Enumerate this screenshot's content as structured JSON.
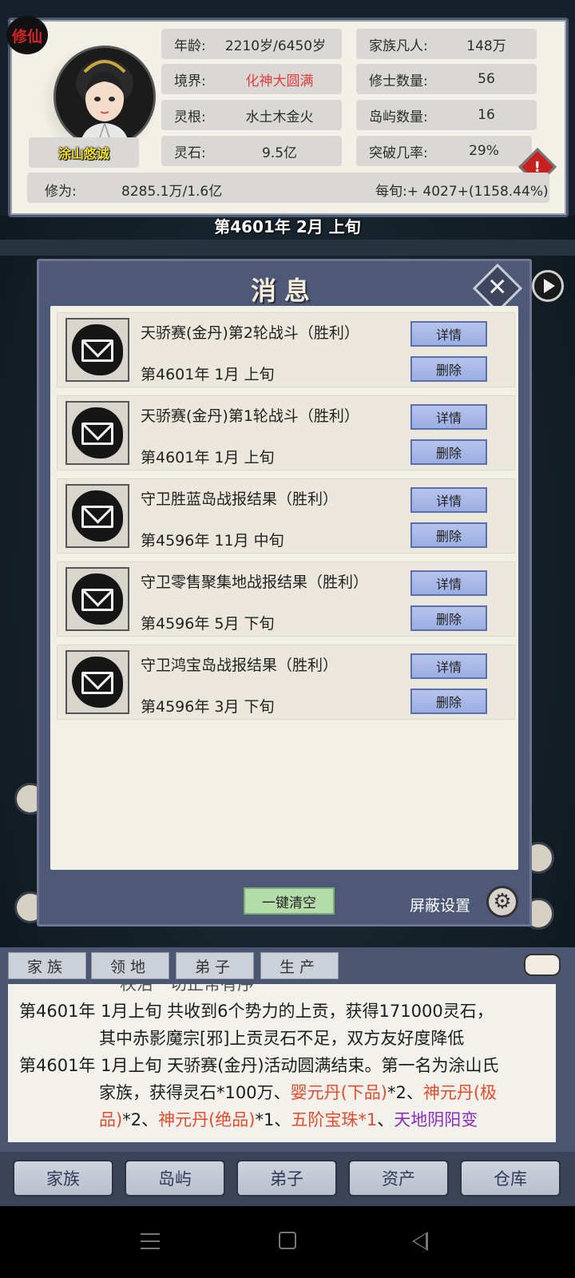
{
  "status": {
    "badge": "修仙",
    "name": "涂山悠诚",
    "age_label": "年龄:",
    "age_value": "2210岁/6450岁",
    "realm_label": "境界:",
    "realm_value": "化神大圆满",
    "root_label": "灵根:",
    "root_value": "水土木金火",
    "stone_label": "灵石:",
    "stone_value": "9.5亿",
    "mortals_label": "家族凡人:",
    "mortals_value": "148万",
    "cultivators_label": "修士数量:",
    "cultivators_value": "56",
    "islands_label": "岛屿数量:",
    "islands_value": "16",
    "breakthrough_label": "突破几率:",
    "breakthrough_value": "29%",
    "warning": "!",
    "cultivation_label": "修为:",
    "cultivation_value": "8285.1万/1.6亿",
    "rate": "每旬:+ 4027+(1158.44%)",
    "realm_color": "#e63c3c"
  },
  "current_date": "第4601年 2月 上旬",
  "dialog": {
    "title": "消息",
    "close": "✕",
    "details_label": "详情",
    "delete_label": "删除",
    "messages": [
      {
        "title": "天骄赛(金丹)第2轮战斗（胜利）",
        "date": "第4601年 1月 上旬"
      },
      {
        "title": "天骄赛(金丹)第1轮战斗（胜利）",
        "date": "第4601年 1月 上旬"
      },
      {
        "title": "守卫胜蓝岛战报结果（胜利）",
        "date": "第4596年 11月 中旬"
      },
      {
        "title": "守卫零售聚集地战报结果（胜利）",
        "date": "第4596年 5月 下旬"
      },
      {
        "title": "守卫鸿宝岛战报结果（胜利）",
        "date": "第4596年 3月 下旬"
      }
    ],
    "clear_all": "一键清空",
    "shield_settings": "屏蔽设置"
  },
  "log_tabs": [
    "家族",
    "领地",
    "弟子",
    "生产"
  ],
  "log": {
    "l0": "秩治一切正常有序",
    "l1_date": "第4601年",
    "l1_text": "1月上旬 共收到6个势力的上贡，获得171000灵石，",
    "l2_text": "其中赤影魔宗[邪]上贡灵石不足，双方友好度降低",
    "l3_date": "第4601年",
    "l3_text": "1月上旬 天骄赛(金丹)活动圆满结束。第一名为涂山氏",
    "l4_a": "家族，获得灵石*100万、",
    "l4_b": "婴元丹(下品)",
    "l4_c": "*2、",
    "l4_d": "神元丹(极",
    "l5_a": "品)",
    "l5_b": "*2、",
    "l5_c": "神元丹(绝品)",
    "l5_d": "*1、",
    "l5_e": "五阶宝珠*1",
    "l5_f": "、",
    "l5_g": "天地阴阳变"
  },
  "nav": [
    "家族",
    "岛屿",
    "弟子",
    "资产",
    "仓库"
  ]
}
